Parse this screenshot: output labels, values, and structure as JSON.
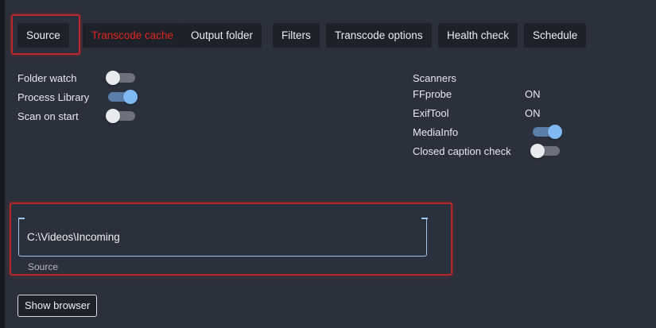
{
  "tabs": [
    {
      "label": "Source",
      "active": true
    },
    {
      "label": "Transcode cache",
      "color": "#e0241b"
    },
    {
      "label": "Output folder"
    },
    {
      "label": "Filters"
    },
    {
      "label": "Transcode options"
    },
    {
      "label": "Health check"
    },
    {
      "label": "Schedule"
    }
  ],
  "source_options": [
    {
      "label": "Folder watch",
      "state": "off"
    },
    {
      "label": "Process Library",
      "state": "on"
    },
    {
      "label": "Scan on start",
      "state": "off"
    }
  ],
  "scanners": {
    "title": "Scanners",
    "items": [
      {
        "label": "FFprobe",
        "value": "ON"
      },
      {
        "label": "ExifTool",
        "value": "ON"
      },
      {
        "label": "MediaInfo",
        "state": "on"
      },
      {
        "label": "Closed caption check",
        "state": "off"
      }
    ]
  },
  "source_field": {
    "value": "C:\\Videos\\Incoming",
    "label": "Source"
  },
  "show_browser_label": "Show browser",
  "colors": {
    "highlight": "#c0262a",
    "accent": "#7fb8f2",
    "background": "#2a303c"
  }
}
